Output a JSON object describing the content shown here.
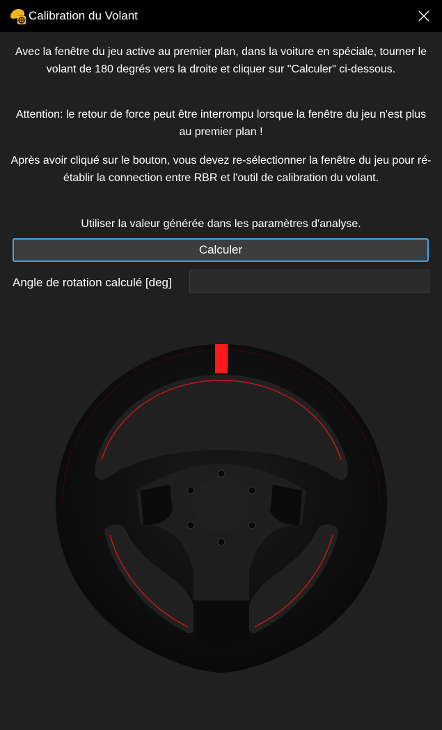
{
  "window": {
    "title": "Calibration du Volant",
    "app_icon": "steering-helmet-icon",
    "close_icon": "close-icon"
  },
  "instructions": {
    "p1": "Avec la fenêtre du jeu active au premier plan, dans la voiture en spéciale, tourner le volant de 180 degrés vers la droite et cliquer sur \"Calculer\" ci-dessous.",
    "p2": "Attention: le retour de force peut être interrompu lorsque la fenêtre du jeu n'est plus au premier plan !",
    "p3": "Après avoir cliqué sur le bouton, vous devez re-sélectionner la fenêtre du jeu pour ré-établir la connection entre RBR et l'outil de calibration du volant.",
    "p4": "Utiliser la valeur générée dans les paramètres d'analyse."
  },
  "calculate_button": {
    "label": "Calculer"
  },
  "angle": {
    "label": "Angle de rotation calculé [deg]",
    "value": ""
  },
  "colors": {
    "background": "#202020",
    "titlebar": "#000000",
    "button_border": "#4aa3e0",
    "wheel_marker": "#ff1a1a",
    "stitching": "#c0161c"
  }
}
